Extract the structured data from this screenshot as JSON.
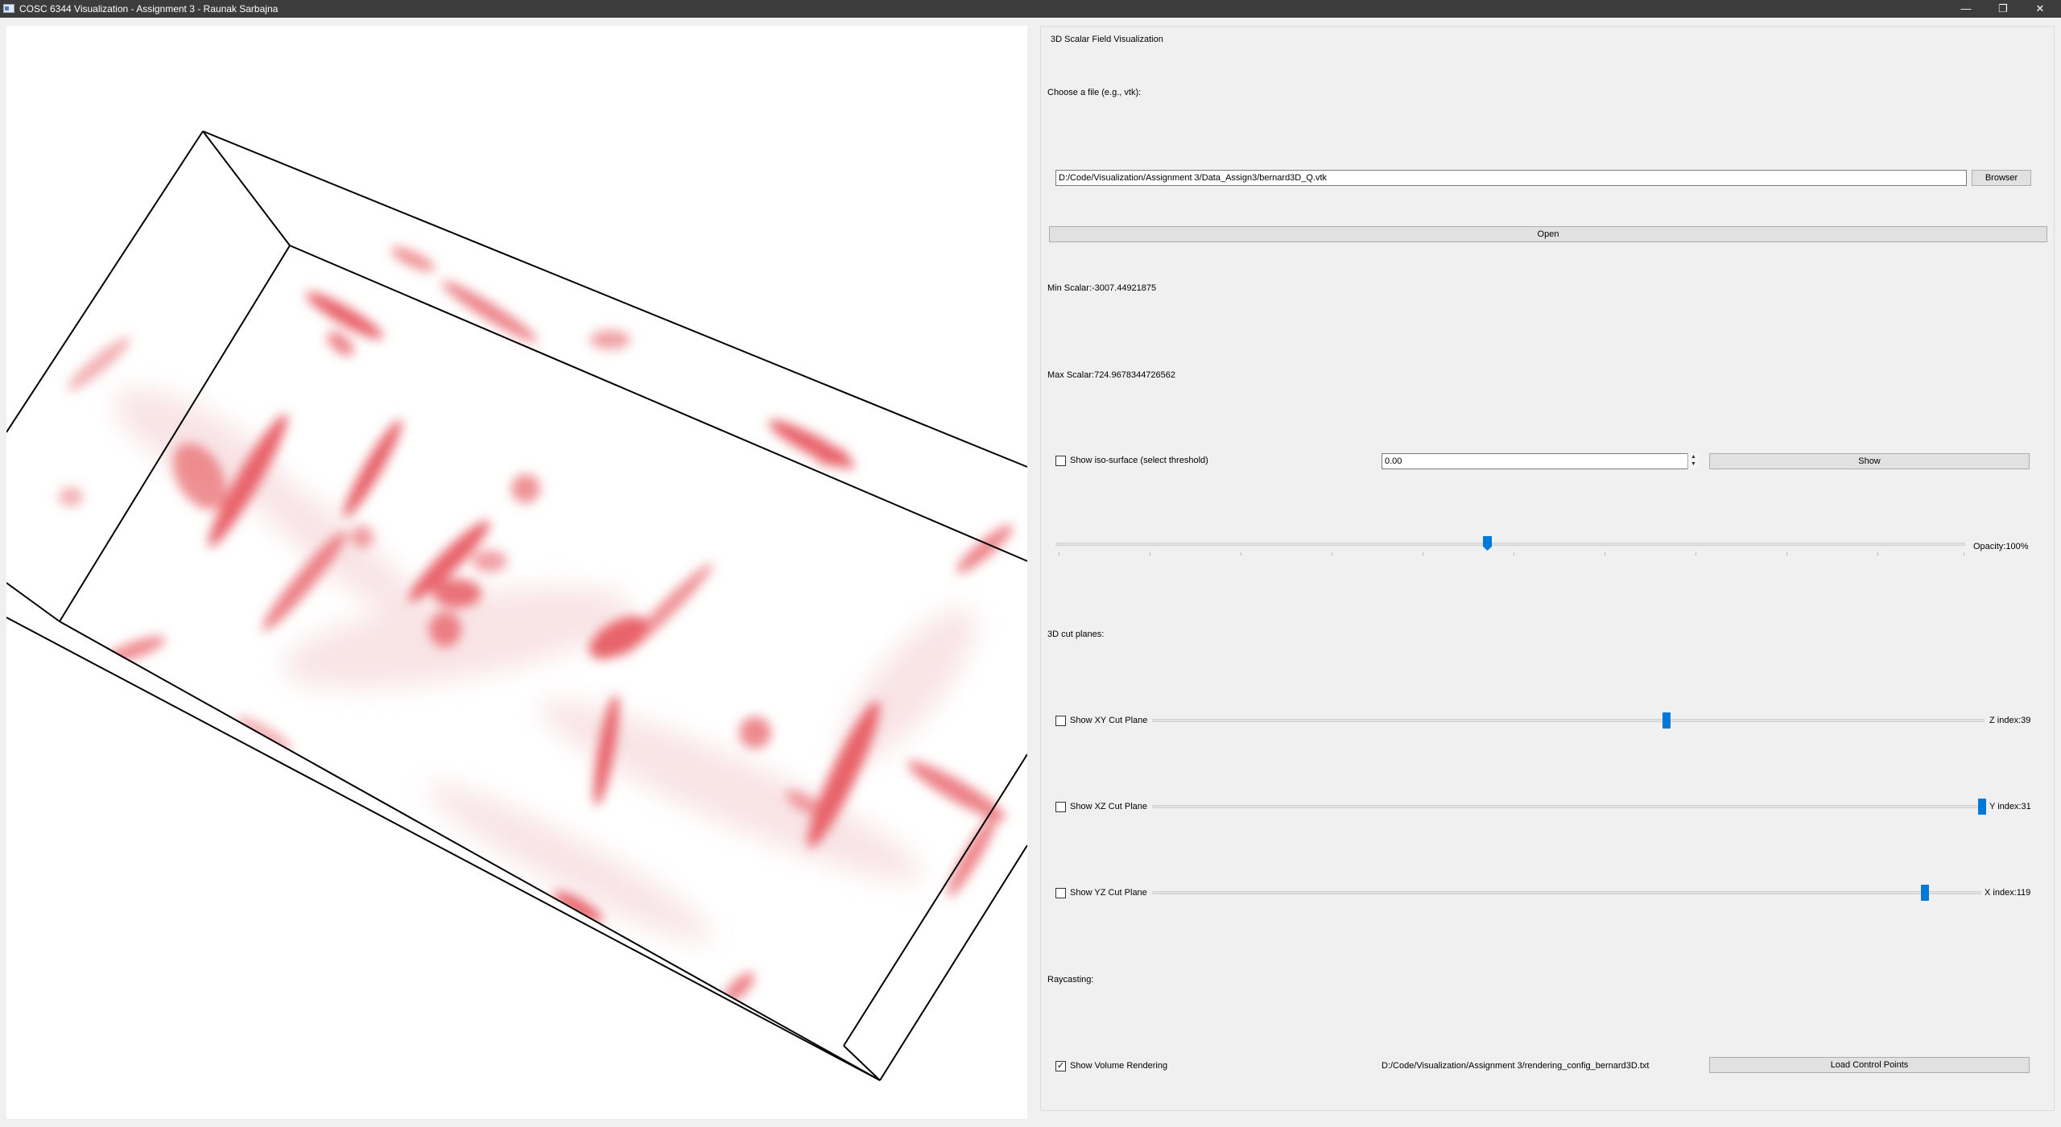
{
  "window": {
    "title": "COSC 6344 Visualization - Assignment 3 - Raunak Sarbajna",
    "minimize": "—",
    "restore": "❐",
    "close": "✕"
  },
  "viewport": {
    "content": "volume-rendering",
    "blob_color": "#e8646a",
    "background": "#ffffff",
    "bbox_color": "#000000"
  },
  "panel": {
    "group_title": "3D Scalar Field Visualization",
    "file_label": "Choose a file (e.g., vtk):",
    "file_path": "D:/Code/Visualization/Assignment 3/Data_Assign3/bernard3D_Q.vtk",
    "browse_label": "Browser",
    "open_label": "Open",
    "min_scalar": "Min Scalar:-3007.44921875",
    "max_scalar": "Max Scalar:724.9678344726562",
    "iso": {
      "checkbox_label": "Show iso-surface (select threshold)",
      "checked": false,
      "threshold_value": "0.00",
      "show_label": "Show"
    },
    "opacity": {
      "label": "Opacity:100%",
      "slider_fraction": 0.49
    },
    "cut_planes_label": "3D cut planes:",
    "cut_planes": [
      {
        "checkbox_label": "Show XY Cut Plane",
        "checked": false,
        "index_label": "Z index:39",
        "slider_fraction": 0.62
      },
      {
        "checkbox_label": "Show XZ Cut Plane",
        "checked": false,
        "index_label": "Y index:31",
        "slider_fraction": 1.0
      },
      {
        "checkbox_label": "Show YZ Cut Plane",
        "checked": false,
        "index_label": "X index:119",
        "slider_fraction": 0.93
      }
    ],
    "raycasting_label": "Raycasting:",
    "volume": {
      "checkbox_label": "Show Volume Rendering",
      "checked": true,
      "config_path": "D:/Code/Visualization/Assignment 3/rendering_config_bernard3D.txt",
      "load_label": "Load Control Points"
    },
    "accent": "#0078d7"
  }
}
